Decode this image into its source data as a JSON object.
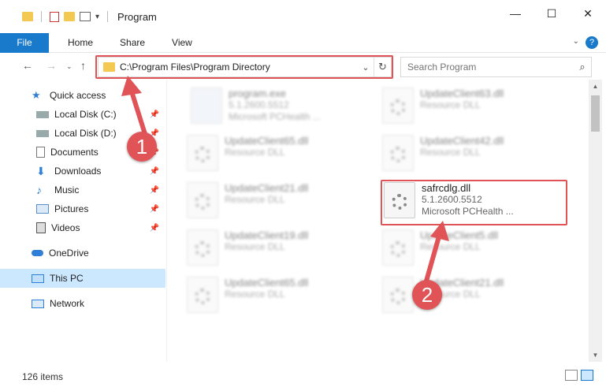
{
  "window": {
    "title": "Program",
    "controls": {
      "minimize": "—",
      "maximize": "☐",
      "close": "✕"
    }
  },
  "ribbon": {
    "tabs": [
      "File",
      "Home",
      "Share",
      "View"
    ],
    "help": "?"
  },
  "address": {
    "path": "C:\\Program Files\\Program Directory",
    "search_placeholder": "Search Program"
  },
  "nav": {
    "items": [
      {
        "label": "Quick access",
        "icon": "star-icon",
        "pinned": false
      },
      {
        "label": "Local Disk (C:)",
        "icon": "drive-icon",
        "pinned": true
      },
      {
        "label": "Local Disk (D:)",
        "icon": "drive-icon",
        "pinned": true
      },
      {
        "label": "Documents",
        "icon": "documents-icon",
        "pinned": true
      },
      {
        "label": "Downloads",
        "icon": "download-icon",
        "pinned": true
      },
      {
        "label": "Music",
        "icon": "music-icon",
        "pinned": true
      },
      {
        "label": "Pictures",
        "icon": "pictures-icon",
        "pinned": true
      },
      {
        "label": "Videos",
        "icon": "videos-icon",
        "pinned": true
      },
      {
        "label": "OneDrive",
        "icon": "cloud-icon",
        "pinned": false
      },
      {
        "label": "This PC",
        "icon": "computer-icon",
        "pinned": false,
        "selected": true
      },
      {
        "label": "Network",
        "icon": "network-icon",
        "pinned": false
      }
    ]
  },
  "files": {
    "left": [
      {
        "name": "program.exe",
        "line2": "5.1.2600.5512",
        "line3": "Microsoft PCHealth ..."
      },
      {
        "name": "UpdateClient65.dll",
        "line2": "Resource DLL",
        "line3": ""
      },
      {
        "name": "UpdateClient21.dll",
        "line2": "Resource DLL",
        "line3": ""
      },
      {
        "name": "UpdateClient19.dll",
        "line2": "Resource DLL",
        "line3": ""
      },
      {
        "name": "UpdateClient65.dll",
        "line2": "Resource DLL",
        "line3": ""
      }
    ],
    "right": [
      {
        "name": "UpdateClient63.dll",
        "line2": "Resource DLL",
        "line3": ""
      },
      {
        "name": "UpdateClient42.dll",
        "line2": "Resource DLL",
        "line3": ""
      },
      {
        "name": "safrcdlg.dll",
        "line2": "5.1.2600.5512",
        "line3": "Microsoft PCHealth ..."
      },
      {
        "name": "UpdateClient5.dll",
        "line2": "Resource DLL",
        "line3": ""
      },
      {
        "name": "UpdateClient21.dll",
        "line2": "Resource DLL",
        "line3": ""
      }
    ]
  },
  "status": {
    "count": "126 items"
  },
  "callouts": {
    "first": "1",
    "second": "2"
  },
  "colors": {
    "accent": "#1979ca",
    "highlight": "#e05357",
    "selected": "#cce8ff"
  }
}
